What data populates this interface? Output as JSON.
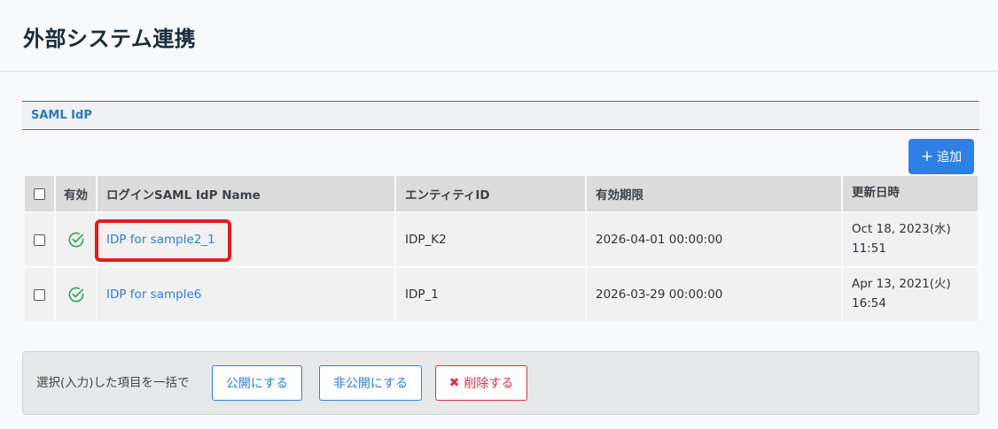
{
  "page": {
    "title": "外部システム連携"
  },
  "section": {
    "title": "SAML IdP"
  },
  "toolbar": {
    "add_label": "追加",
    "add_icon": "plus-icon"
  },
  "table": {
    "headers": {
      "valid": "有効",
      "name": "ログインSAML IdP Name",
      "entity_id": "エンティティID",
      "expiration": "有効期限",
      "updated": "更新日時"
    },
    "rows": [
      {
        "name": "IDP for sample2_1",
        "entity_id": "IDP_K2",
        "expiration": "2026-04-01 00:00:00",
        "updated_date": "Oct 18, 2023(水)",
        "updated_time": "11:51",
        "valid_icon": "check-circle-icon"
      },
      {
        "name": "IDP for sample6",
        "entity_id": "IDP_1",
        "expiration": "2026-03-29 00:00:00",
        "updated_date": "Apr 13, 2021(火)",
        "updated_time": "16:54",
        "valid_icon": "check-circle-icon"
      }
    ]
  },
  "bulk": {
    "label": "選択(入力)した項目を一括で",
    "publish_label": "公開にする",
    "unpublish_label": "非公開にする",
    "delete_label": "削除する",
    "delete_icon": "x-icon"
  },
  "colors": {
    "accent": "#2f80e4",
    "link": "#2f7fd6",
    "valid_icon": "#2e9e5b",
    "danger": "#d9324a",
    "highlight": "#e11d1d"
  }
}
